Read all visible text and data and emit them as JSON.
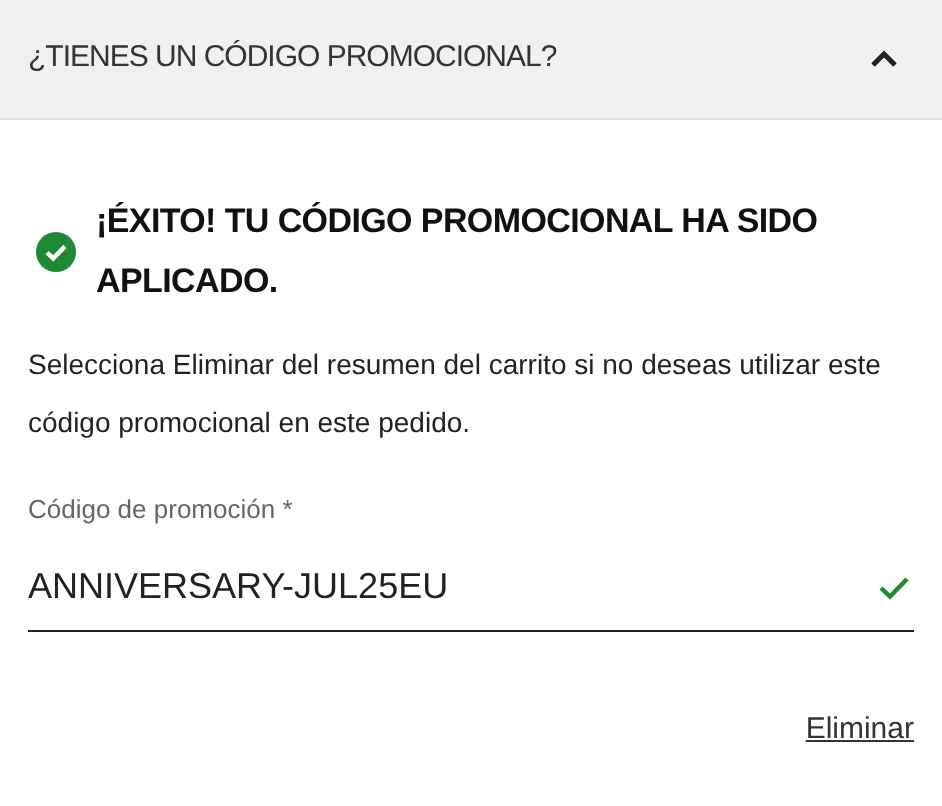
{
  "accordion": {
    "title": "¿TIENES UN CÓDIGO PROMOCIONAL?",
    "expanded": true
  },
  "success": {
    "title": "¡ÉXITO! TU CÓDIGO PROMOCIONAL HA SIDO APLICADO.",
    "message": "Selecciona Eliminar del resumen del carrito si no deseas utilizar este código promocional en este pedido."
  },
  "promo_field": {
    "label": "Código de promoción *",
    "value": "ANNIVERSARY-JUL25EU",
    "valid": true
  },
  "remove_link": "Eliminar"
}
